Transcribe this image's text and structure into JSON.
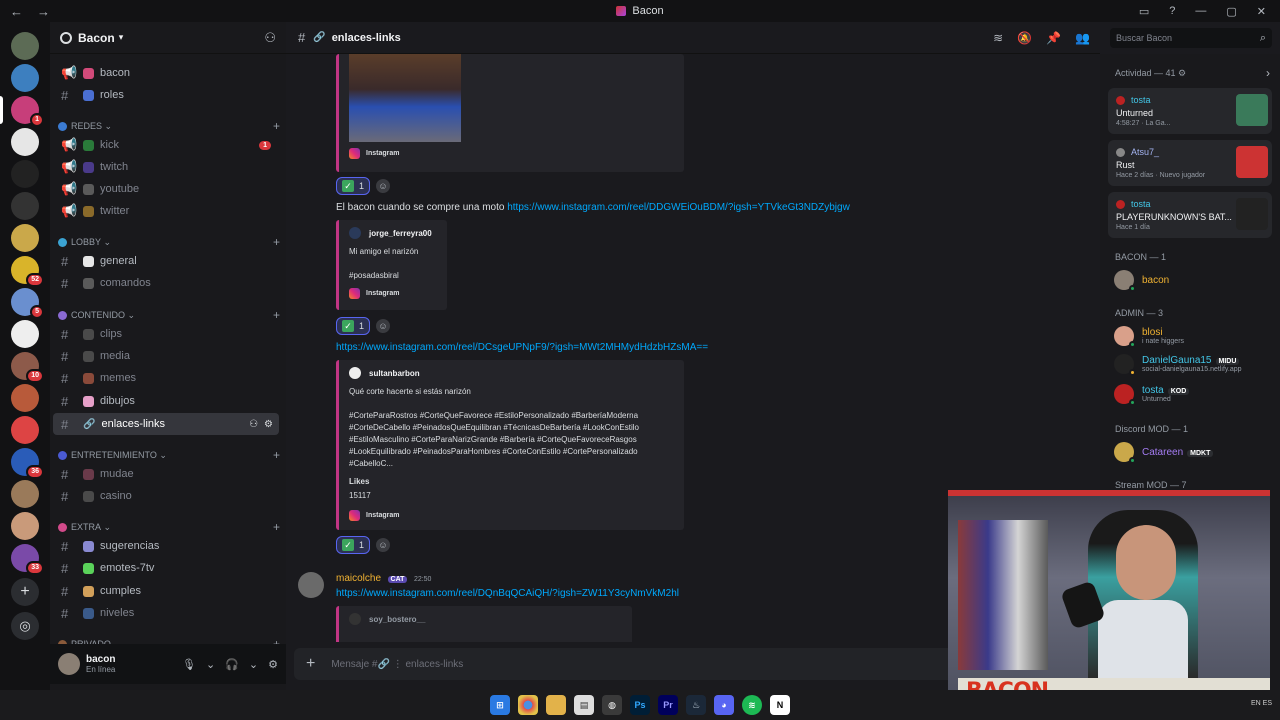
{
  "window": {
    "title": "Bacon",
    "nav_back": "←",
    "nav_fwd": "→",
    "min": "—",
    "max": "▢",
    "close": "✕"
  },
  "server": {
    "name": "Bacon"
  },
  "guild_badges": [
    "1",
    "52",
    "5",
    "10",
    "36",
    "33"
  ],
  "channels": {
    "top": [
      {
        "name": "bacon",
        "icon": "megaphone"
      },
      {
        "name": "roles",
        "icon": "hash"
      }
    ],
    "categories": [
      {
        "name": "REDES",
        "channels": [
          "kick",
          "twitch",
          "youtube",
          "twitter"
        ],
        "badge": "1"
      },
      {
        "name": "LOBBY",
        "channels": [
          "general",
          "comandos"
        ]
      },
      {
        "name": "CONTENIDO",
        "channels": [
          "clips",
          "media",
          "memes",
          "dibujos",
          "enlaces-links"
        ]
      },
      {
        "name": "ENTRETENIMIENTO",
        "channels": [
          "mudae",
          "casino"
        ]
      },
      {
        "name": "EXTRA",
        "channels": [
          "sugerencias",
          "emotes-7tv",
          "cumples",
          "niveles"
        ]
      },
      {
        "name": "PRIVADO"
      }
    ]
  },
  "user": {
    "name": "bacon",
    "status": "En línea"
  },
  "topbar": {
    "channel": "enlaces-links"
  },
  "search": {
    "placeholder": "Buscar Bacon"
  },
  "messages": {
    "embed1": {
      "provider": "Instagram"
    },
    "react_count": "1",
    "msg2_text": "El bacon cuando se compre una moto",
    "msg2_link": "https://www.instagram.com/reel/DDGWEiOuBDM/?igsh=YTVkeGt3NDZybjgw",
    "embed2": {
      "author": "jorge_ferreyra00",
      "desc": "Mi amigo el narizón\n\n#posadasbiral",
      "provider": "Instagram"
    },
    "msg3_link": "https://www.instagram.com/reel/DCsgeUPNpF9/?igsh=MWt2MHMydHdzbHZsMA==",
    "embed3": {
      "author": "sultanbarbon",
      "desc": "Qué corte hacerte si estás narizón\n\n#CorteParaRostros #CorteQueFavorece #EstiloPersonalizado #BarberíaModerna\n#CorteDeCabello #PeinadosQueEquilibran #TécnicasDeBarbería #LookConEstilo\n#EstiloMasculino #CorteParaNarizGrande #Barbería #CorteQueFavoreceRasgos\n#LookEquilibrado #PeinadosParaHombres #CorteConEstilo #CortePersonalizado\n#CabelloC...",
      "likes_label": "Likes",
      "likes": "15117",
      "provider": "Instagram"
    },
    "msg4": {
      "author": "maicolche",
      "tag": "CAT",
      "time": "22:50",
      "link": "https://www.instagram.com/reel/DQnBqQCAiQH/?igsh=ZW11Y3cyNmVkM2hl",
      "embed_author": "soy_bostero__"
    }
  },
  "composer": {
    "placeholder": "Mensaje #🔗 ⋮ enlaces-links"
  },
  "members": {
    "activity_header": "Actividad — 41",
    "activities": [
      {
        "name": "tosta",
        "game": "Unturned",
        "detail": "4:58:27 · La Ga..."
      },
      {
        "name": "Atsu7_",
        "game": "Rust",
        "detail": "Hace 2 días · Nuevo jugador"
      },
      {
        "name": "tosta",
        "game": "PLAYERUNKNOWN'S BAT...",
        "detail": "Hace 1 día"
      }
    ],
    "groups": [
      {
        "header": "BACON — 1",
        "members": [
          {
            "name": "bacon",
            "sub": "",
            "tag": "",
            "color": "#f0b232"
          }
        ]
      },
      {
        "header": "ADMIN — 3",
        "members": [
          {
            "name": "blosi",
            "sub": "i nate higgers",
            "tag": "",
            "color": "#f0b232"
          },
          {
            "name": "DanielGauna15",
            "sub": "social-danielgauna15.netlify.app",
            "tag": "MIDU",
            "color": "#43c7e8"
          },
          {
            "name": "tosta",
            "sub": "Unturned",
            "tag": "KOD",
            "color": "#43c7e8"
          }
        ]
      },
      {
        "header": "Discord MOD — 1",
        "members": [
          {
            "name": "Catareen",
            "sub": "",
            "tag": "MDKT",
            "color": "#a47cf2"
          }
        ]
      },
      {
        "header": "Stream MOD — 7",
        "members": []
      }
    ]
  },
  "webcam": {
    "banner": "BACON"
  },
  "taskbar": {
    "apps": [
      "win",
      "chrome",
      "files",
      "notes",
      "discord-canary",
      "ps",
      "pr",
      "steam",
      "discord",
      "spotify",
      "notion"
    ],
    "clock": "EN ES"
  }
}
